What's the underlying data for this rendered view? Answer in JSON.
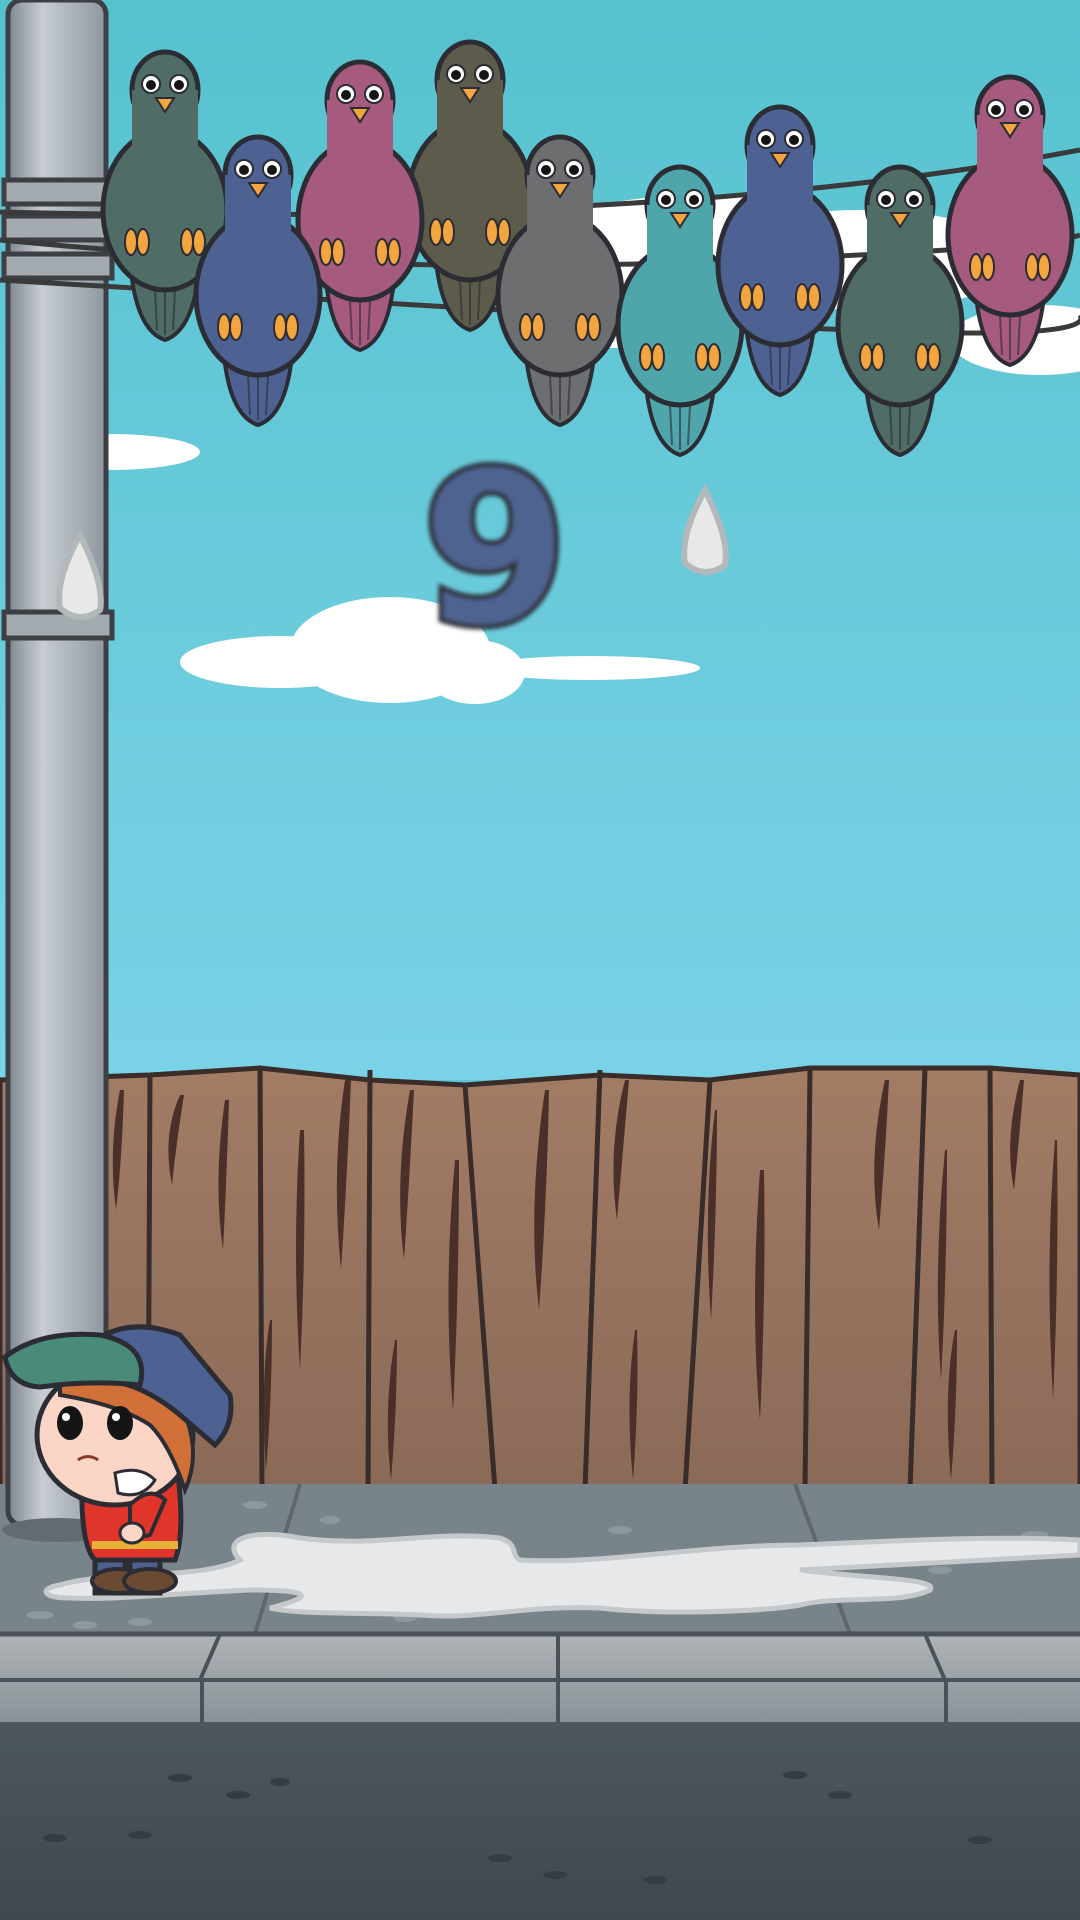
{
  "game": {
    "score": "9",
    "score_color": "#4e6390"
  },
  "colors": {
    "sky_top": "#56c2ce",
    "sky_bottom": "#7ad2e6",
    "fence": "#a07a63",
    "pole": "#a5adb4",
    "sidewalk": "#79838a",
    "road": "#4a545b",
    "splat": "#e6e8e9"
  },
  "pigeons": [
    {
      "color": "#4f6d66"
    },
    {
      "color": "#4d6192"
    },
    {
      "color": "#a65a7e"
    },
    {
      "color": "#5d5b4c"
    },
    {
      "color": "#6d6e70"
    },
    {
      "color": "#4ea5aa"
    },
    {
      "color": "#4d6192"
    },
    {
      "color": "#4f6d66"
    },
    {
      "color": "#a65a7e"
    }
  ],
  "droppings": [
    {
      "color": "#e8e8e8"
    },
    {
      "color": "#e8e8e8"
    }
  ],
  "player": {
    "cap_color": "#4d6192",
    "brim_color": "#4a8a7a",
    "shirt_color": "#e0352b",
    "hair_color": "#d2703a"
  }
}
